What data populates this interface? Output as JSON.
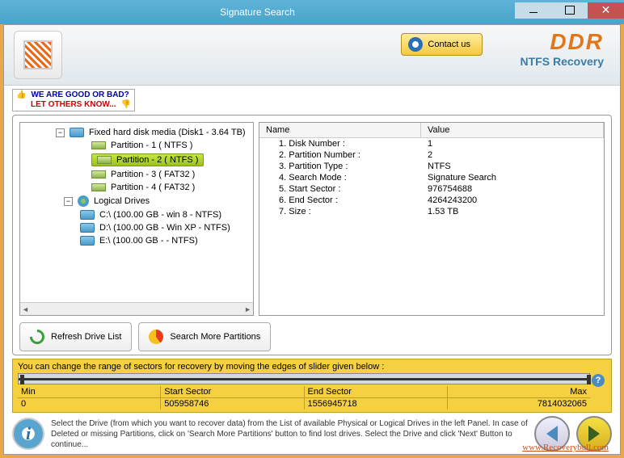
{
  "window": {
    "title": "Signature Search"
  },
  "header": {
    "contact_label": "Contact us",
    "brand": "DDR",
    "subtitle": "NTFS Recovery"
  },
  "feedback": {
    "line1": "WE ARE GOOD OR BAD?",
    "line2": "LET OTHERS KNOW..."
  },
  "tree": {
    "root": "Fixed hard disk media (Disk1 - 3.64 TB)",
    "partitions": [
      "Partition - 1 ( NTFS )",
      "Partition - 2 ( NTFS )",
      "Partition - 3 ( FAT32 )",
      "Partition - 4 ( FAT32 )"
    ],
    "logical_label": "Logical Drives",
    "logical": [
      "C:\\ (100.00 GB - win 8 - NTFS)",
      "D:\\ (100.00 GB - Win XP - NTFS)",
      "E:\\ (100.00 GB -  - NTFS)"
    ]
  },
  "details": {
    "col_name": "Name",
    "col_value": "Value",
    "rows": [
      {
        "n": "1. Disk Number :",
        "v": "1"
      },
      {
        "n": "2. Partition Number :",
        "v": "2"
      },
      {
        "n": "3. Partition Type :",
        "v": "NTFS"
      },
      {
        "n": "4. Search Mode :",
        "v": "Signature Search"
      },
      {
        "n": "5. Start Sector :",
        "v": "976754688"
      },
      {
        "n": "6. End Sector :",
        "v": "4264243200"
      },
      {
        "n": "7. Size :",
        "v": "1.53 TB"
      }
    ]
  },
  "actions": {
    "refresh": "Refresh Drive List",
    "search": "Search More Partitions"
  },
  "slider": {
    "instruction": "You can change the range of sectors for recovery by moving the edges of slider given below :",
    "min_label": "Min",
    "start_label": "Start Sector",
    "end_label": "End Sector",
    "max_label": "Max",
    "min": "0",
    "start": "505958746",
    "end": "1556945718",
    "max": "7814032065"
  },
  "footer": {
    "info": "Select the Drive (from which you want to recover data) from the List of available Physical or Logical Drives in the left Panel. In case of Deleted or missing Partitions, click on 'Search More Partitions' button to find lost drives. Select the Drive and click 'Next' Button to continue..."
  },
  "url": "www.Recoverybull.com"
}
